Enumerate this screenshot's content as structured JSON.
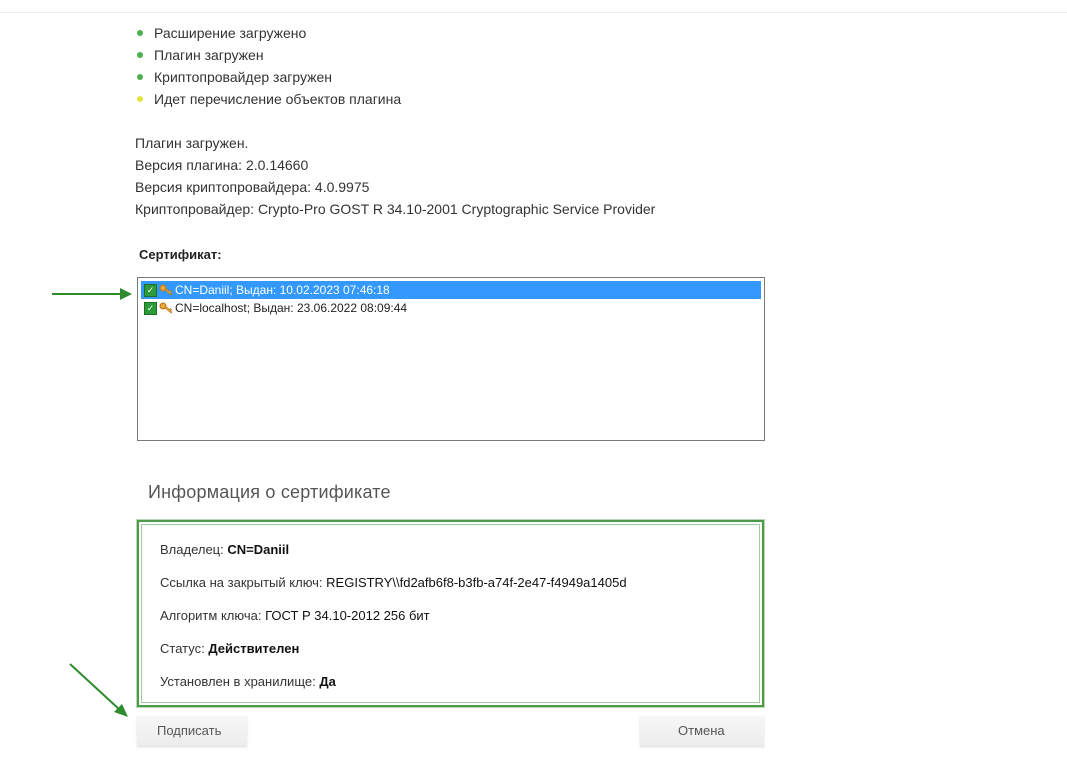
{
  "status": [
    {
      "label": "Расширение загружено",
      "color": "#4caf50"
    },
    {
      "label": "Плагин загружен",
      "color": "#4caf50"
    },
    {
      "label": "Криптопровайдер загружен",
      "color": "#4caf50"
    },
    {
      "label": "Идет перечисление объектов плагина",
      "color": "#e6e23c"
    }
  ],
  "plugin": {
    "loaded": "Плагин загружен.",
    "plugin_version": "Версия плагина: 2.0.14660",
    "csp_version": "Версия криптопровайдера: 4.0.9975",
    "csp_name": "Криптопровайдер: Crypto-Pro GOST R 34.10-2001 Cryptographic Service Provider"
  },
  "certificates": {
    "label": "Сертификат:",
    "items": [
      {
        "text": "CN=Daniil; Выдан: 10.02.2023 07:46:18",
        "selected": true
      },
      {
        "text": "CN=localhost; Выдан: 23.06.2022 08:09:44",
        "selected": false
      }
    ]
  },
  "info": {
    "heading": "Информация о сертификате",
    "owner_label": "Владелец: ",
    "owner_value": "CN=Daniil",
    "key_link_label": "Ссылка на закрытый ключ: ",
    "key_link_value": "REGISTRY\\\\fd2afb6f8-b3fb-a74f-2e47-f4949a1405d",
    "algorithm_label": "Алгоритм ключа: ",
    "algorithm_value": "ГОСТ Р 34.10-2012 256 бит",
    "status_label": "Статус: ",
    "status_value": "Действителен",
    "installed_label": "Установлен в хранилище: ",
    "installed_value": "Да"
  },
  "buttons": {
    "sign": "Подписать",
    "cancel": "Отмена"
  },
  "colors": {
    "accent_green": "#4c9a4a",
    "selection_blue": "#3399ff",
    "arrow_green": "#2e8b2e"
  }
}
